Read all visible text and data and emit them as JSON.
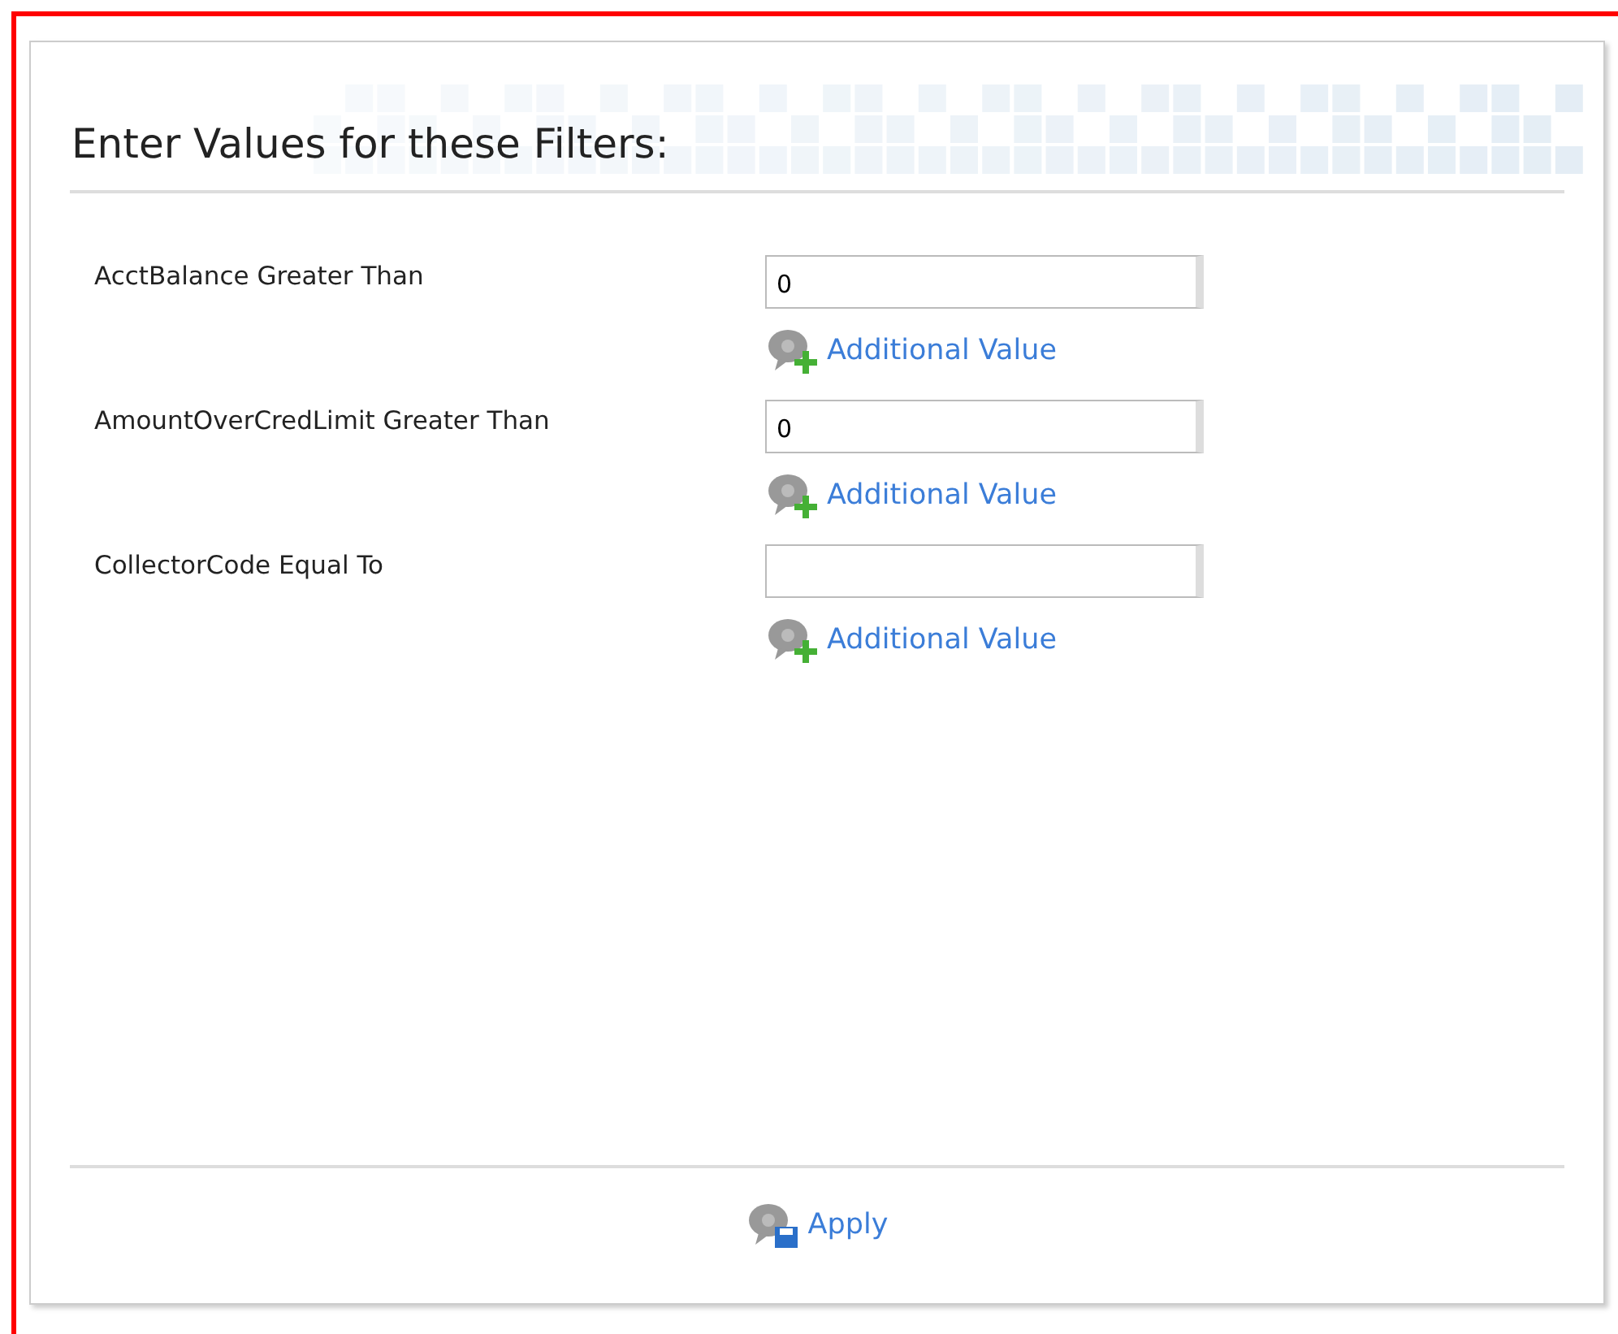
{
  "panel": {
    "title": "Enter Values for these Filters:"
  },
  "filters": [
    {
      "label": "AcctBalance Greater Than",
      "value": "0",
      "add_link": "Additional Value"
    },
    {
      "label": "AmountOverCredLimit Greater Than",
      "value": "0",
      "add_link": "Additional Value"
    },
    {
      "label": "CollectorCode Equal To",
      "add_link": "Additional Value"
    }
  ],
  "apply_button": "Apply"
}
